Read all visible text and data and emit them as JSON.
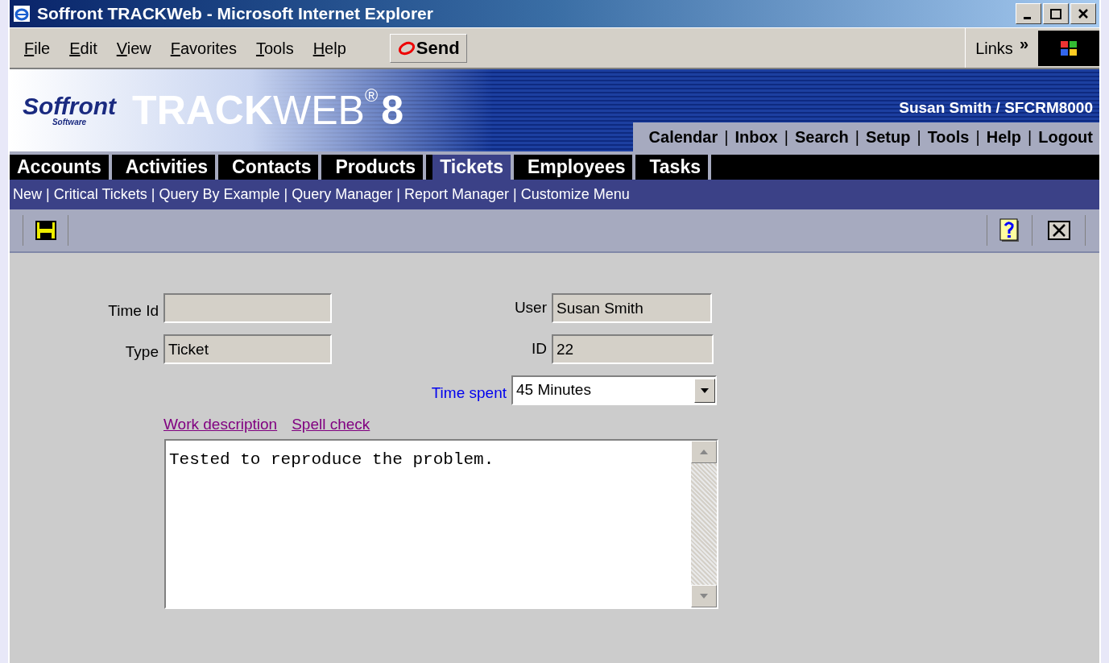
{
  "window": {
    "title": "Soffront TRACKWeb - Microsoft Internet Explorer"
  },
  "menu_bar": {
    "items": [
      {
        "label": "File"
      },
      {
        "label": "Edit"
      },
      {
        "label": "View"
      },
      {
        "label": "Favorites"
      },
      {
        "label": "Tools"
      },
      {
        "label": "Help"
      }
    ],
    "send_button": "Send",
    "links_label": "Links",
    "links_chevron": "»"
  },
  "header": {
    "logo": {
      "name": "Soffront",
      "tagline": "Software"
    },
    "product": {
      "bold": "TRACK",
      "light": "WEB",
      "mark": "®",
      "version": "8"
    },
    "user": "Susan Smith / SFCRM8000",
    "separator": "|",
    "links": [
      "Calendar",
      "Inbox",
      "Search",
      "Setup",
      "Tools",
      "Help",
      "Logout"
    ]
  },
  "tabs": [
    {
      "label": "Accounts",
      "selected": false
    },
    {
      "label": "Activities",
      "selected": false
    },
    {
      "label": "Contacts",
      "selected": false
    },
    {
      "label": "Products",
      "selected": false
    },
    {
      "label": "Tickets",
      "selected": true
    },
    {
      "label": "Employees",
      "selected": false
    },
    {
      "label": "Tasks",
      "selected": false
    }
  ],
  "submenu": {
    "separator": "|",
    "items": [
      "New",
      "Critical Tickets",
      "Query By Example",
      "Query Manager",
      "Report Manager",
      "Customize Menu"
    ]
  },
  "form": {
    "time_id": {
      "label": "Time Id"
    },
    "type": {
      "label": "Type",
      "value": "Ticket"
    },
    "user": {
      "label": "User",
      "value": "Susan Smith"
    },
    "id": {
      "label": "ID",
      "value": "22"
    },
    "time_spent": {
      "label": "Time spent",
      "value": "45 Minutes"
    },
    "work_description_link": "Work description",
    "spell_check_link": "Spell check",
    "work_description": "Tested to reproduce the problem."
  }
}
